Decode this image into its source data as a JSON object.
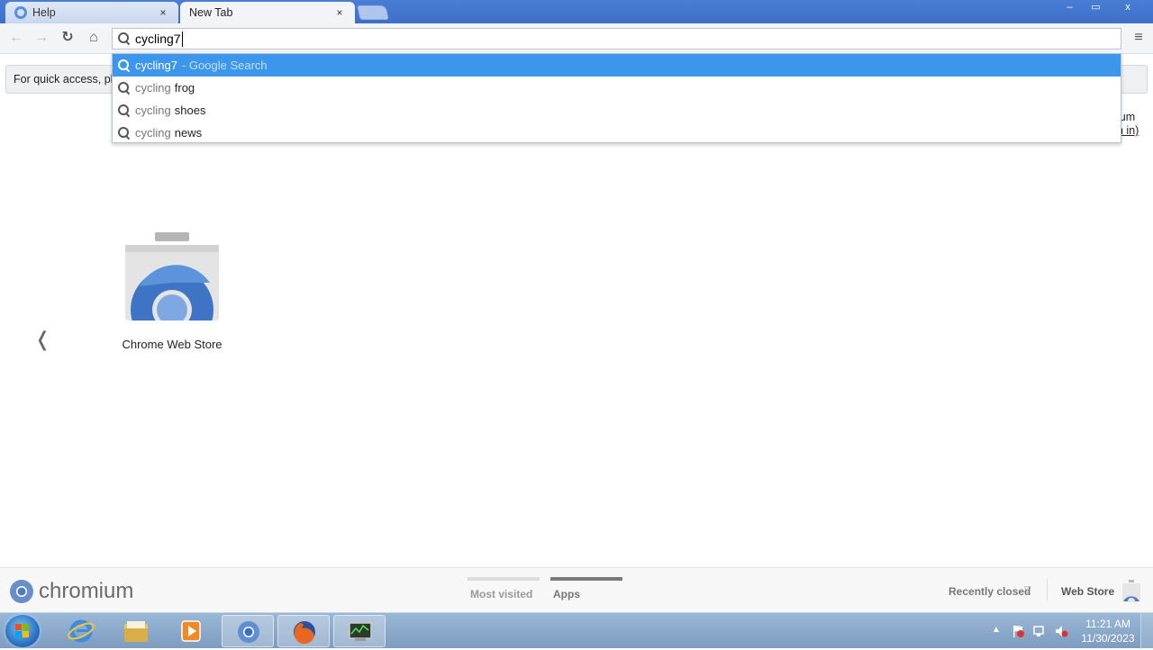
{
  "browser": {
    "tabs": [
      {
        "title": "Help",
        "close": "×"
      },
      {
        "title": "New Tab",
        "close": "×"
      }
    ],
    "window_controls": {
      "minimize": "–",
      "maximize": "▭",
      "close": "x"
    },
    "toolbar": {
      "back": "←",
      "forward": "→",
      "reload": "↻",
      "home": "⌂",
      "menu": "≡",
      "omnibox_text": "cycling7"
    }
  },
  "autocomplete": [
    {
      "prefix": "cycling7",
      "suffix": "",
      "hint": "- Google Search",
      "selected": true
    },
    {
      "prefix": "cycling",
      "suffix": "frog",
      "hint": "",
      "selected": false
    },
    {
      "prefix": "cycling",
      "suffix": "shoes",
      "hint": "",
      "selected": false
    },
    {
      "prefix": "cycling",
      "suffix": "news",
      "hint": "",
      "selected": false
    }
  ],
  "bookmark_bar": {
    "text": "For quick access, pla"
  },
  "profile": {
    "name": "ium",
    "signin": "n in)"
  },
  "new_tab": {
    "prev_arrow": "❬",
    "apps": [
      {
        "label": "Chrome Web Store"
      }
    ]
  },
  "footer": {
    "brand": "chromium",
    "most_visited": "Most visited",
    "apps": "Apps",
    "recently_closed": "Recently closed",
    "recently_closed_arrow": "▽",
    "web_store": "Web Store"
  },
  "taskbar": {
    "items": [
      "start-icon",
      "ie-icon",
      "explorer-icon",
      "media-player-icon",
      "chrome-icon",
      "firefox-icon",
      "system-monitor-icon"
    ],
    "tray_arrow": "▲",
    "clock_time": "11:21 AM",
    "clock_date": "11/30/2023"
  },
  "colors": {
    "tabstrip": "#3d6fc9",
    "selected_suggestion": "#3b96ec",
    "taskbar": "#7d9cbf"
  }
}
